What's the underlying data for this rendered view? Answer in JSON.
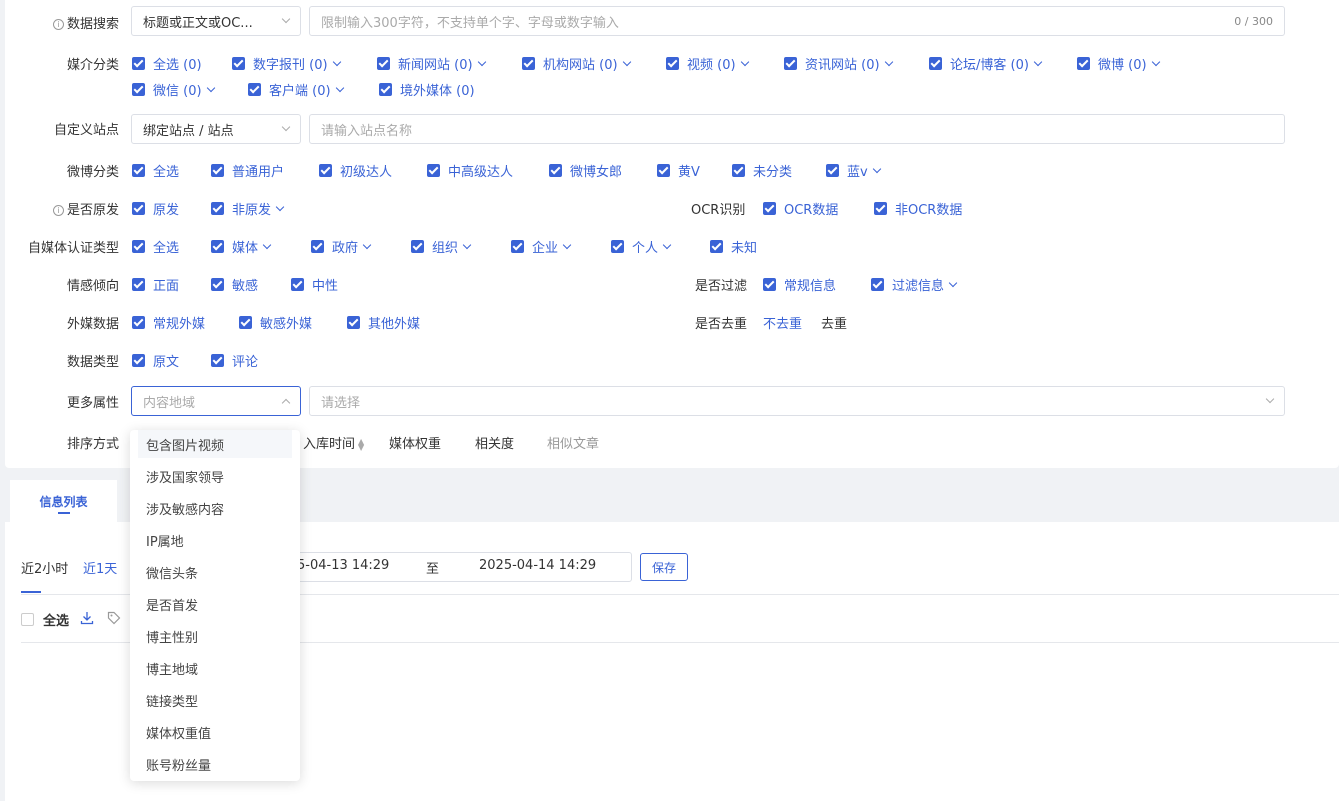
{
  "filters": {
    "search": {
      "label": "数据搜索",
      "field_select": "标题或正文或OC...",
      "placeholder": "限制输入300字符，不支持单个字、字母或数字输入",
      "counter": "0 / 300"
    },
    "media": {
      "label": "媒介分类",
      "options": [
        "全选 (0)",
        "数字报刊 (0)",
        "新闻网站 (0)",
        "机构网站 (0)",
        "视频 (0)",
        "资讯网站 (0)",
        "论坛/博客 (0)",
        "微博 (0)",
        "微信 (0)",
        "客户端 (0)",
        "境外媒体 (0)"
      ]
    },
    "custom_site": {
      "label": "自定义站点",
      "select": "绑定站点 / 站点",
      "placeholder": "请输入站点名称"
    },
    "weibo": {
      "label": "微博分类",
      "options": [
        "全选",
        "普通用户",
        "初级达人",
        "中高级达人",
        "微博女郎",
        "黄V",
        "未分类",
        "蓝v"
      ]
    },
    "original": {
      "label": "是否原发",
      "options": [
        "原发",
        "非原发"
      ]
    },
    "ocr": {
      "label": "OCR识别",
      "options": [
        "OCR数据",
        "非OCR数据"
      ]
    },
    "self_media": {
      "label": "自媒体认证类型",
      "options": [
        "全选",
        "媒体",
        "政府",
        "组织",
        "企业",
        "个人",
        "未知"
      ]
    },
    "sentiment": {
      "label": "情感倾向",
      "options": [
        "正面",
        "敏感",
        "中性"
      ]
    },
    "filter": {
      "label": "是否过滤",
      "options": [
        "常规信息",
        "过滤信息"
      ]
    },
    "foreign": {
      "label": "外媒数据",
      "options": [
        "常规外媒",
        "敏感外媒",
        "其他外媒"
      ]
    },
    "dedupe": {
      "label": "是否去重",
      "options": [
        "不去重",
        "去重"
      ]
    },
    "data_type": {
      "label": "数据类型",
      "options": [
        "原文",
        "评论"
      ]
    },
    "more": {
      "label": "更多属性",
      "select_placeholder": "内容地域",
      "placeholder": "请选择"
    },
    "sort": {
      "label": "排序方式",
      "options": [
        "入库时间",
        "媒体权重",
        "相关度",
        "相似文章"
      ]
    }
  },
  "dropdown": {
    "items": [
      "包含图片视频",
      "涉及国家领导",
      "涉及敏感内容",
      "IP属地",
      "微信头条",
      "是否首发",
      "博主性别",
      "博主地域",
      "链接类型",
      "媒体权重值",
      "账号粉丝量"
    ]
  },
  "list": {
    "tab": "信息列表",
    "time_quick": [
      "近2小时",
      "近1天"
    ],
    "start": "5-04-13 14:29",
    "to": "至",
    "end": "2025-04-14 14:29",
    "save": "保存",
    "select_all": "全选"
  }
}
